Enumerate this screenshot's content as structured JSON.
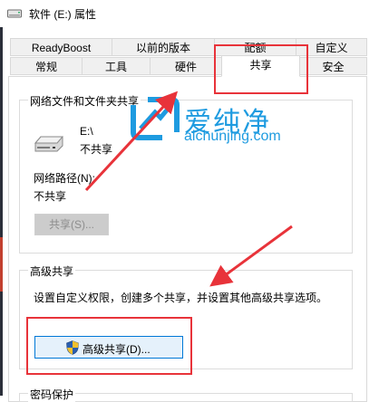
{
  "window": {
    "title": "软件 (E:) 属性"
  },
  "tabs": {
    "row1": [
      "ReadyBoost",
      "以前的版本",
      "配额",
      "自定义"
    ],
    "row2": [
      "常规",
      "工具",
      "硬件",
      "共享",
      "安全"
    ],
    "active": "共享"
  },
  "network_sharing": {
    "group_title": "网络文件和文件夹共享",
    "drive_name": "E:\\",
    "drive_status": "不共享",
    "network_path_label": "网络路径(N):",
    "network_path_value": "不共享",
    "share_button": "共享(S)..."
  },
  "advanced_sharing": {
    "group_title": "高级共享",
    "description": "设置自定义权限，创建多个共享，并设置其他高级共享选项。",
    "button": "高级共享(D)..."
  },
  "password_protection": {
    "group_title": "密码保护"
  },
  "watermark": {
    "brand": "爱纯净",
    "url": "aichunjing.com"
  },
  "colors": {
    "highlight": "#e8333a",
    "watermark": "#1e9be0",
    "shield_blue": "#2a5fb0",
    "shield_yellow": "#f2c12e"
  }
}
